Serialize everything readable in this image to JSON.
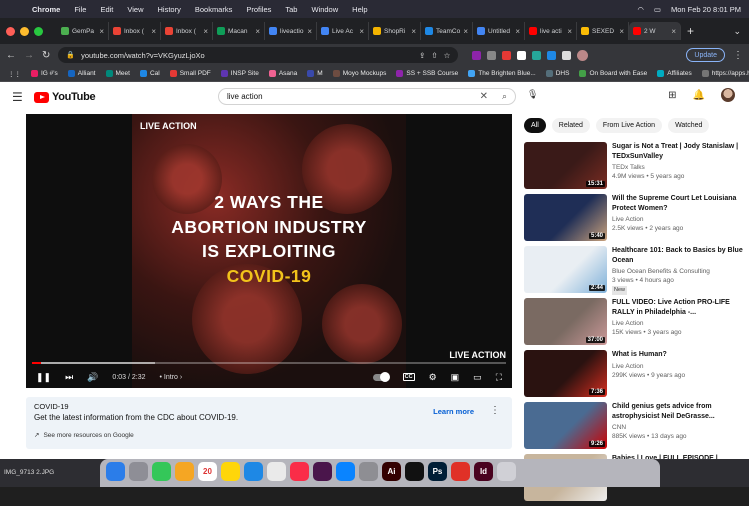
{
  "menubar": {
    "app": "Chrome",
    "items": [
      "File",
      "Edit",
      "View",
      "History",
      "Bookmarks",
      "Profiles",
      "Tab",
      "Window",
      "Help"
    ],
    "clock": "Mon Feb 20  8:01 PM"
  },
  "tabs": [
    {
      "label": "GemPa",
      "color": "#4caf50"
    },
    {
      "label": "Inbox (",
      "color": "#ea4335"
    },
    {
      "label": "Inbox (",
      "color": "#ea4335"
    },
    {
      "label": "Macan",
      "color": "#0f9d58"
    },
    {
      "label": "liveactio",
      "color": "#4285f4"
    },
    {
      "label": "Live Ac",
      "color": "#4285f4"
    },
    {
      "label": "ShopRi",
      "color": "#f4b400"
    },
    {
      "label": "TeamCo",
      "color": "#1e88e5"
    },
    {
      "label": "Untitled",
      "color": "#4285f4"
    },
    {
      "label": "live acti",
      "color": "#ff0000"
    },
    {
      "label": "SEXED",
      "color": "#fbbc05"
    },
    {
      "label": "2 W",
      "color": "#ff0000"
    }
  ],
  "toolbar": {
    "url": "youtube.com/watch?v=VKGyuzLjoXo",
    "update_label": "Update"
  },
  "bookmarks": [
    {
      "label": "IG #'s",
      "color": "#e91e63"
    },
    {
      "label": "Alliant",
      "color": "#1565c0"
    },
    {
      "label": "Meet",
      "color": "#00897b"
    },
    {
      "label": "Cal",
      "color": "#1e88e5"
    },
    {
      "label": "Small PDF",
      "color": "#e53935"
    },
    {
      "label": "INSP Site",
      "color": "#5e35b1"
    },
    {
      "label": "Asana",
      "color": "#f06292"
    },
    {
      "label": "M",
      "color": "#3949ab"
    },
    {
      "label": "Moyo Mockups",
      "color": "#6d4c41"
    },
    {
      "label": "SS + SSB Course",
      "color": "#8e24aa"
    },
    {
      "label": "The Brighten Blue...",
      "color": "#42a5f5"
    },
    {
      "label": "DHS",
      "color": "#546e7a"
    },
    {
      "label": "On Board with Ease",
      "color": "#43a047"
    },
    {
      "label": "Affiliates",
      "color": "#00acc1"
    },
    {
      "label": "https://apps.hy-ve...",
      "color": "#757575"
    }
  ],
  "youtube": {
    "brand": "YouTube",
    "search_query": "live action",
    "video": {
      "watermark": "LIVE ACTION",
      "headline_1": "2 WAYS THE",
      "headline_2": "ABORTION INDUSTRY",
      "headline_3": "IS EXPLOITING",
      "headline_4": "COVID-19",
      "time": "0:03 / 2:32",
      "chapter": "• Intro ›",
      "progress": 0.02,
      "buffered": 0.26
    },
    "banner": {
      "title": "COVID-19",
      "text": "Get the latest information from the CDC about COVID-19.",
      "more": "See more resources on Google",
      "learn_more": "Learn more"
    },
    "chips": [
      "All",
      "Related",
      "From Live Action",
      "Watched"
    ],
    "recommendations": [
      {
        "title": "Sugar is Not a Treat | Jody Stanislaw | TEDxSunValley",
        "channel": "TEDx Talks",
        "stats": "4.9M views • 5 years ago",
        "duration": "15:31",
        "bg": "#3a1a18",
        "accent": "#7a2c22"
      },
      {
        "title": "Will the Supreme Court Let Louisiana Protect Women?",
        "channel": "Live Action",
        "stats": "2.5K views • 2 years ago",
        "duration": "5:40",
        "bg": "#1f2e56",
        "accent": "#c9a27c"
      },
      {
        "title": "Healthcare 101: Back to Basics by Blue Ocean",
        "channel": "Blue Ocean Benefits & Consulting",
        "stats": "3 views • 4 hours ago",
        "badge": "New",
        "duration": "2:44",
        "bg": "#e9eef3",
        "accent": "#7fb1d9"
      },
      {
        "title": "FULL VIDEO: Live Action PRO-LIFE RALLY in Philadelphia -...",
        "channel": "Live Action",
        "stats": "15K views • 3 years ago",
        "duration": "37:00",
        "bg": "#7a6a62",
        "accent": "#c99"
      },
      {
        "title": "What is Human?",
        "channel": "Live Action",
        "stats": "299K views • 9 years ago",
        "duration": "7:36",
        "bg": "#2a1210",
        "accent": "#d62d1f"
      },
      {
        "title": "Child genius gets advice from astrophysicist Neil DeGrasse...",
        "channel": "CNN",
        "stats": "885K views • 13 days ago",
        "duration": "9:26",
        "bg": "#4a6b92",
        "accent": "#cc0000"
      },
      {
        "title": "Babies | Love | FULL EPISODE |",
        "channel": "",
        "stats": "",
        "duration": "",
        "bg": "#c7b59d",
        "accent": "#eee"
      }
    ]
  },
  "dock": {
    "file": "IMG_9713 2.JPG",
    "apps": [
      {
        "name": "finder-icon",
        "color": "#2b7de9",
        "glyph": ""
      },
      {
        "name": "launchpad-icon",
        "color": "#8e8e96",
        "glyph": ""
      },
      {
        "name": "messages-icon",
        "color": "#34c759",
        "glyph": ""
      },
      {
        "name": "photos-icon",
        "color": "#f5a623",
        "glyph": ""
      },
      {
        "name": "calendar-icon",
        "color": "#ffffff",
        "glyph": "20"
      },
      {
        "name": "notes-icon",
        "color": "#ffd60a",
        "glyph": ""
      },
      {
        "name": "safari-icon",
        "color": "#1e88e5",
        "glyph": ""
      },
      {
        "name": "chrome-icon",
        "color": "#eaeaea",
        "glyph": ""
      },
      {
        "name": "music-icon",
        "color": "#fa2d48",
        "glyph": ""
      },
      {
        "name": "slack-icon",
        "color": "#4a154b",
        "glyph": ""
      },
      {
        "name": "appstore-icon",
        "color": "#0a84ff",
        "glyph": ""
      },
      {
        "name": "settings-icon",
        "color": "#8e8e93",
        "glyph": ""
      },
      {
        "name": "illustrator-icon",
        "color": "#330000",
        "glyph": "Ai"
      },
      {
        "name": "figma-icon",
        "color": "#111111",
        "glyph": ""
      },
      {
        "name": "photoshop-icon",
        "color": "#001e36",
        "glyph": "Ps"
      },
      {
        "name": "acrobat-icon",
        "color": "#e03127",
        "glyph": ""
      },
      {
        "name": "indesign-icon",
        "color": "#49021f",
        "glyph": "Id"
      },
      {
        "name": "trash-icon",
        "color": "#d0d0d6",
        "glyph": ""
      }
    ]
  }
}
